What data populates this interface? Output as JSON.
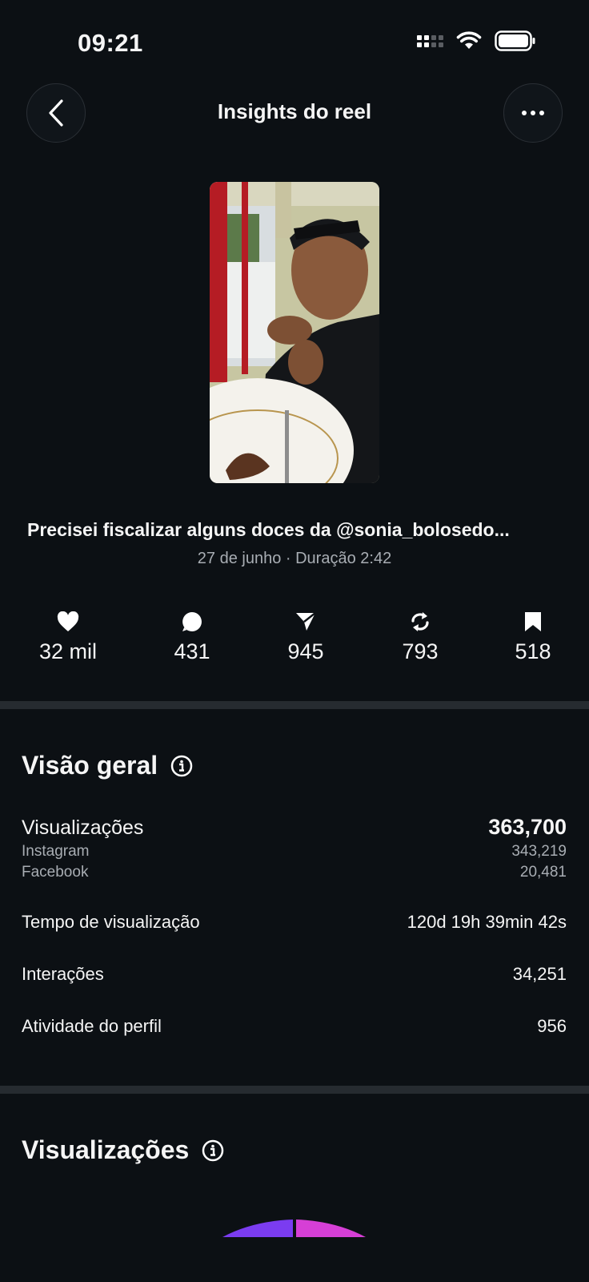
{
  "status_bar": {
    "time": "09:21"
  },
  "header": {
    "title": "Insights do reel"
  },
  "reel": {
    "caption": "Precisei fiscalizar alguns doces da @sonia_bolosedo...",
    "meta": "27 de junho · Duração 2:42"
  },
  "stats": [
    {
      "icon": "heart-icon",
      "value": "32 mil"
    },
    {
      "icon": "comment-icon",
      "value": "431"
    },
    {
      "icon": "share-icon",
      "value": "945"
    },
    {
      "icon": "repost-icon",
      "value": "793"
    },
    {
      "icon": "bookmark-icon",
      "value": "518"
    }
  ],
  "overview": {
    "title": "Visão geral",
    "views_label": "Visualizações",
    "views_value": "363,700",
    "instagram_label": "Instagram",
    "instagram_value": "343,219",
    "facebook_label": "Facebook",
    "facebook_value": "20,481",
    "watch_time_label": "Tempo de visualização",
    "watch_time_value": "120d 19h 39min 42s",
    "interactions_label": "Interações",
    "interactions_value": "34,251",
    "profile_activity_label": "Atividade do perfil",
    "profile_activity_value": "956"
  },
  "views_section": {
    "title": "Visualizações"
  },
  "colors": {
    "background": "#0c1014",
    "divider": "#262b30",
    "arc_instagram": "#7b3cf0",
    "arc_facebook": "#d63fd6"
  }
}
